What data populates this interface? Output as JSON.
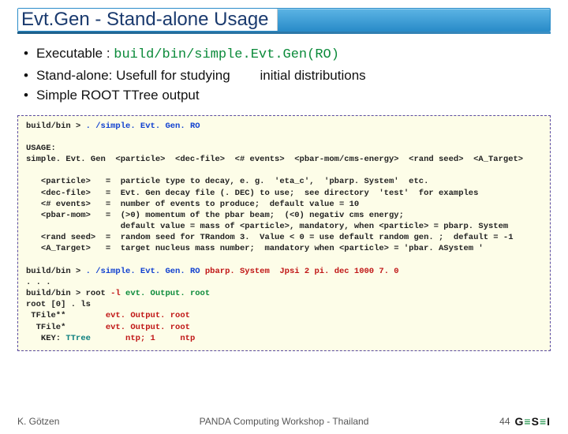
{
  "title": "Evt.Gen - Stand-alone Usage",
  "bullets": {
    "b1_pre": "Executable  : ",
    "b1_code": "build/bin/simple.Evt.Gen(RO)",
    "b2": "Stand-alone: Usefull for studying        initial distributions",
    "b3": "Simple ROOT TTree output"
  },
  "code": {
    "line1_a": "build/bin > ",
    "line1_b": ". /simple. Evt. Gen. RO",
    "blank1": "",
    "usage1": "USAGE:",
    "usage2": "simple. Evt. Gen  <particle>  <dec-file>  <# events>  <pbar-mom/cms-energy>  <rand seed>  <A_Target>",
    "blank2": "",
    "p1": "   <particle>   =  particle type to decay, e. g.  'eta_c',  'pbarp. System'  etc.",
    "p2": "   <dec-file>   =  Evt. Gen decay file (. DEC) to use;  see directory  'test'  for examples",
    "p3": "   <# events>   =  number of events to produce;  default value = 10",
    "p4": "   <pbar-mom>   =  (>0) momentum of the pbar beam;  (<0) negativ cms energy;",
    "p5": "                   default value = mass of <particle>, mandatory, when <particle> = pbarp. System",
    "p6": "   <rand seed>  =  random seed for TRandom 3.  Value < 0 = use default random gen. ;  default = -1",
    "p7": "   <A_Target>   =  target nucleus mass number;  mandatory when <particle> = 'pbar. ASystem '",
    "blank3": "",
    "r1_a": "build/bin > ",
    "r1_b": ". /simple. Evt. Gen. RO",
    "r1_c": " pbarp. System  Jpsi 2 pi. dec 1000 7. 0",
    "r2": ". . .",
    "r3_a": "build/bin > root ",
    "r3_b": "-l",
    "r3_c": " evt. Output. root",
    "r4": "root [0] . ls",
    "r5_a": " TFile**        ",
    "r5_b": "evt. Output. root",
    "r6_a": "  TFile*        ",
    "r6_b": "evt. Output. root",
    "r7_a": "   KEY: ",
    "r7_b": "TTree",
    "r7_c": "       ",
    "r7_d": "ntp; 1     ntp"
  },
  "footer": {
    "author": "K. Götzen",
    "event": "PANDA Computing Workshop - Thailand",
    "page": "44",
    "logo": "GSI"
  }
}
